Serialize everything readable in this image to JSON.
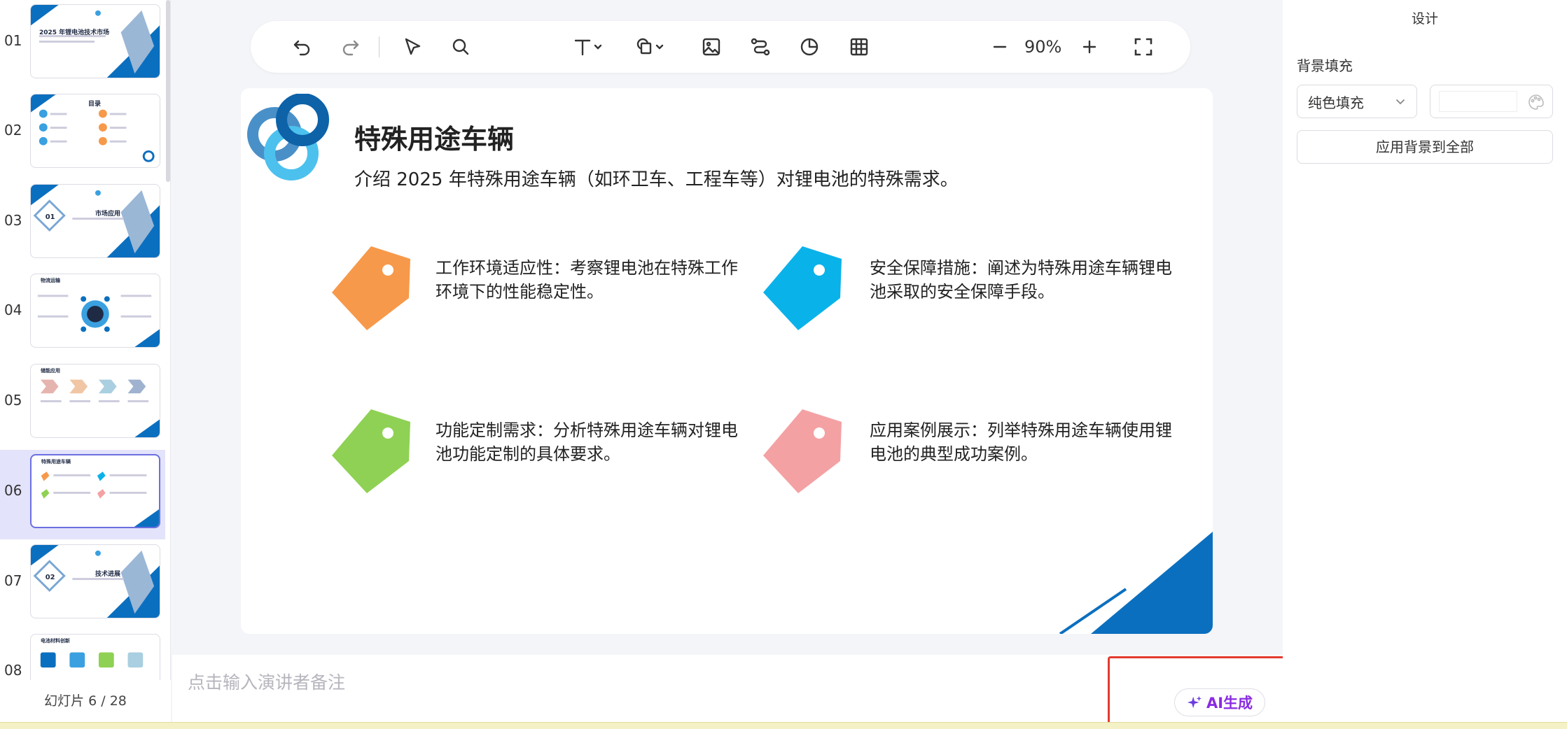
{
  "thumbnails": [
    {
      "num": "01",
      "title": "2025 年锂电池技术市场",
      "kind": "cover"
    },
    {
      "num": "02",
      "title": "目录",
      "kind": "toc"
    },
    {
      "num": "03",
      "title": "市场应用",
      "kind": "section",
      "badge": "01"
    },
    {
      "num": "04",
      "title": "物流运输",
      "kind": "circle"
    },
    {
      "num": "05",
      "title": "储能应用",
      "kind": "chevrons"
    },
    {
      "num": "06",
      "title": "特殊用途车辆",
      "kind": "tags",
      "active": true
    },
    {
      "num": "07",
      "title": "技术进展",
      "kind": "section",
      "badge": "02"
    },
    {
      "num": "08",
      "title": "电池材料创新",
      "kind": "icons"
    }
  ],
  "slide_counter": "幻灯片 6 / 28",
  "toolbar": {
    "zoom": "90%",
    "tools": [
      "undo-icon",
      "redo-icon",
      "select-icon",
      "search-icon",
      "text-icon",
      "shape-icon",
      "image-icon",
      "connector-icon",
      "chart-icon",
      "table-icon",
      "zoom-out-icon",
      "zoom-in-icon",
      "fullscreen-icon"
    ]
  },
  "slide": {
    "title": "特殊用途车辆",
    "subtitle": "介绍 2025 年特殊用途车辆（如环卫车、工程车等）对锂电池的特殊需求。",
    "points": [
      {
        "text": "工作环境适应性：考察锂电池在特殊工作环境下的性能稳定性。",
        "color": "#f7994a"
      },
      {
        "text": "安全保障措施：阐述为特殊用途车辆锂电池采取的安全保障手段。",
        "color": "#0ab2ea"
      },
      {
        "text": "功能定制需求：分析特殊用途车辆对锂电池功能定制的具体要求。",
        "color": "#8fd154"
      },
      {
        "text": "应用案例展示：列举特殊用途车辆使用锂电池的典型成功案例。",
        "color": "#f4a1a4"
      }
    ],
    "accent": "#0b6fbf"
  },
  "notes": {
    "placeholder": "点击输入演讲者备注"
  },
  "ai_button": {
    "label": "AI生成",
    "color": "#8a2be2"
  },
  "right_panel": {
    "tab": "设计",
    "background_fill_label": "背景填充",
    "fill_type": "纯色填充",
    "apply_all": "应用背景到全部"
  }
}
